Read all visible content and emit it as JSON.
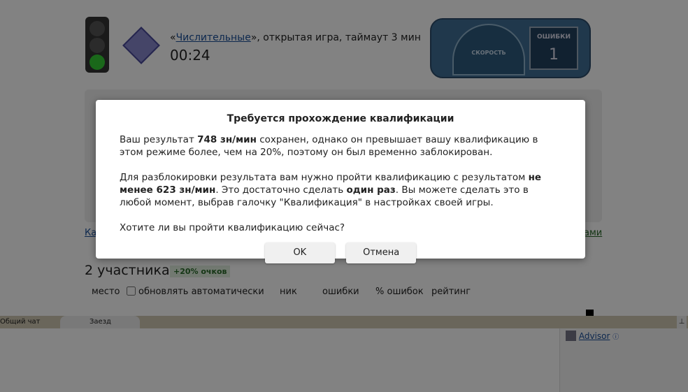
{
  "game": {
    "quote_open": "«",
    "name": "Числительные",
    "quote_rest": "», открытая игра, таймаут 3 мин",
    "timer": "00:24"
  },
  "dashboard": {
    "speed_label": "СКОРОСТЬ",
    "speed_ticks": [
      "0",
      "200",
      "400",
      "600",
      "800"
    ],
    "errors_label": "ОШИБКИ",
    "errors_value": "1"
  },
  "race": {
    "participants": "2 участника",
    "bonus": "+20% очков",
    "left_link_fragment": "Ка",
    "right_link_fragment": "ами"
  },
  "table_headers": {
    "place": "место",
    "auto_update": "обновлять автоматически",
    "nick": "ник",
    "errors": "ошибки",
    "error_pct": "% ошибок",
    "rating": "рейтинг"
  },
  "chat": {
    "tabs": [
      "Общий чат",
      "Заезд"
    ],
    "users": [
      {
        "name": "Advisor"
      }
    ],
    "pin_icon": "pin-icon"
  },
  "dialog": {
    "title": "Требуется прохождение квалификации",
    "p1_a": "Ваш результат ",
    "p1_b": "748 зн/мин",
    "p1_c": " сохранен, однако он превышает вашу квалификацию в этом режиме более, чем на 20%, поэтому он был временно заблокирован.",
    "p2_a": "Для разблокировки результата вам нужно пройти квалификацию с результатом ",
    "p2_b": "не менее 623 зн/мин",
    "p2_c": ". Это достаточно сделать ",
    "p2_d": "один раз",
    "p2_e": ". Вы можете сделать это в любой момент, выбрав галочку \"Квалификация\" в настройках своей игры.",
    "p3": "Хотите ли вы пройти квалификацию сейчас?",
    "ok": "OK",
    "cancel": "Отмена"
  }
}
